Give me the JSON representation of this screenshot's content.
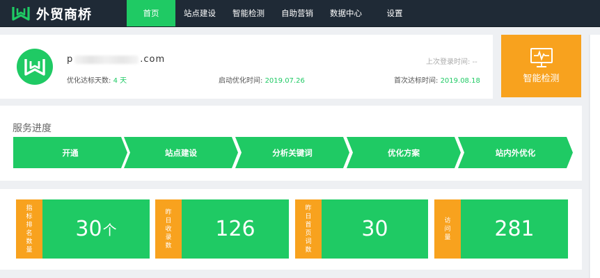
{
  "brand": {
    "logo_icon": "wq-logo-icon",
    "name": "外贸商桥"
  },
  "nav": {
    "items": [
      {
        "label": "首页",
        "active": true
      },
      {
        "label": "站点建设",
        "active": false
      },
      {
        "label": "智能检测",
        "active": false
      },
      {
        "label": "自助营销",
        "active": false
      },
      {
        "label": "数据中心",
        "active": false
      },
      {
        "label": "设置",
        "active": false
      }
    ]
  },
  "account": {
    "avatar_icon": "wq-avatar-icon",
    "domain_prefix": "p",
    "domain_suffix": ".com",
    "last_login_label": "上次登录时间: --",
    "opt_days_label": "优化达标天数:",
    "opt_days_value": "4 天",
    "start_label": "启动优化时间:",
    "start_value": "2019.07.26",
    "first_reach_label": "首次达标时间:",
    "first_reach_value": "2019.08.18"
  },
  "smart_check": {
    "icon": "monitor-pulse-icon",
    "label": "智能检测"
  },
  "progress": {
    "title": "服务进度",
    "steps": [
      "开通",
      "站点建设",
      "分析关键词",
      "优化方案",
      "站内外优化"
    ]
  },
  "stats": [
    {
      "label": "指标排名数量",
      "value": "30",
      "unit": "个"
    },
    {
      "label": "昨日收录数",
      "value": "126",
      "unit": ""
    },
    {
      "label": "昨日首页词数",
      "value": "30",
      "unit": ""
    },
    {
      "label": "访问量",
      "value": "281",
      "unit": ""
    }
  ],
  "colors": {
    "accent_green": "#1fca64",
    "accent_orange": "#f8a21e",
    "nav_bg": "#1f2a36"
  }
}
